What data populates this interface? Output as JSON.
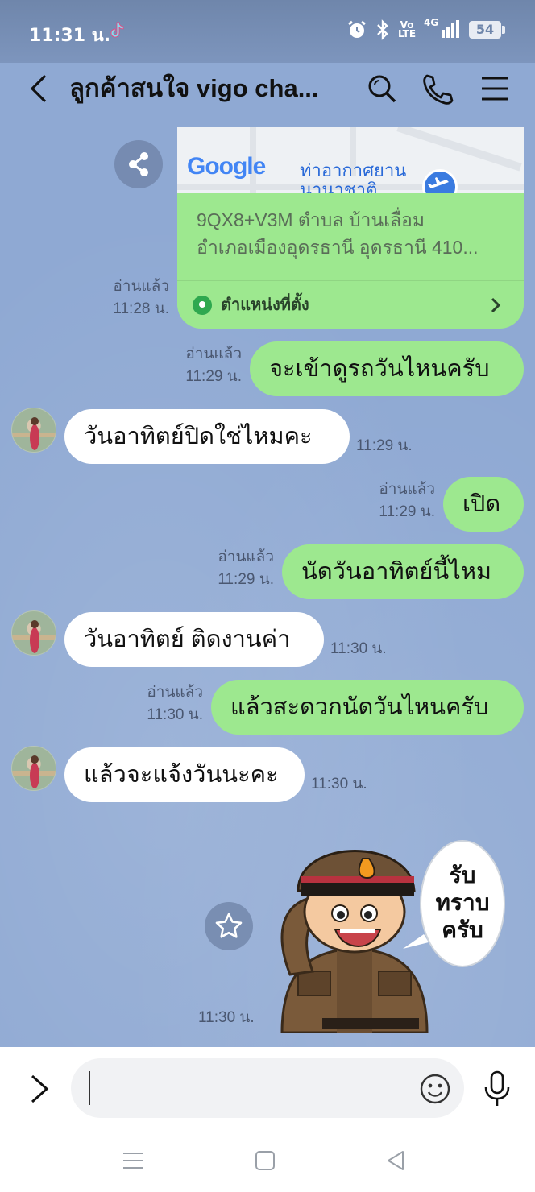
{
  "status_bar": {
    "time": "11:31 น.",
    "volte": "Vo LTE",
    "network": "4G",
    "battery": "54"
  },
  "header": {
    "title": "ลูกค้าสนใจ vigo cha...",
    "icons": [
      "back-arrow-icon",
      "search-icon",
      "phone-icon",
      "menu-icon"
    ]
  },
  "location_card": {
    "map_brand": "Google",
    "map_label_1": "ท่าอากาศยาน",
    "map_label_2": "นานาชาติ",
    "address_line1": "9QX8+V3M ตำบล บ้านเลื่อม",
    "address_line2": "อำเภอเมืองอุดรธานี อุดรธานี 410...",
    "footer_label": "ตำแหน่งที่ตั้ง",
    "read": "อ่านแล้ว",
    "time": "11:28 น."
  },
  "messages": [
    {
      "side": "me",
      "text": "จะเข้าดูรถวันไหนครับ",
      "read": "อ่านแล้ว",
      "time": "11:29 น."
    },
    {
      "side": "them",
      "text": "วันอาทิตย์ปิดใช่ไหมคะ",
      "time": "11:29 น."
    },
    {
      "side": "me",
      "text": "เปิด",
      "read": "อ่านแล้ว",
      "time": "11:29 น."
    },
    {
      "side": "me",
      "text": "นัดวันอาทิตย์นี้ไหม",
      "read": "อ่านแล้ว",
      "time": "11:29 น."
    },
    {
      "side": "them",
      "text": "วันอาทิตย์ ติดงานค่า",
      "time": "11:30 น."
    },
    {
      "side": "me",
      "text": "แล้วสะดวกนัดวันไหนครับ",
      "read": "อ่านแล้ว",
      "time": "11:30 น."
    },
    {
      "side": "them",
      "text": "แล้วจะแจ้งวันนะคะ",
      "time": "11:30 น."
    }
  ],
  "sticker": {
    "line1": "รับ",
    "line2": "ทราบ",
    "line3": "ครับ",
    "time": "11:30 น."
  },
  "input": {
    "placeholder": ""
  },
  "colors": {
    "chat_bg": "#8fa9d3",
    "my_bubble": "#9de88f",
    "their_bubble": "#ffffff",
    "status_bar": "#7389ae"
  }
}
